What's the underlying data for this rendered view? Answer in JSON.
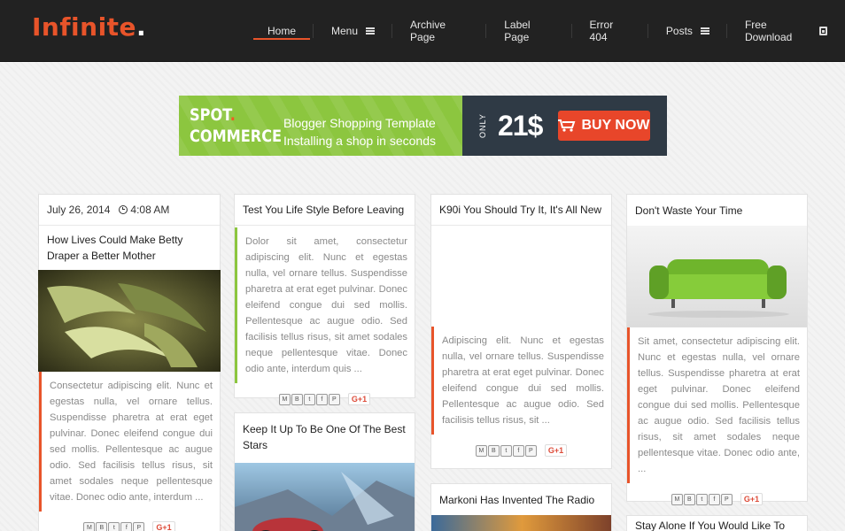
{
  "header": {
    "logo_text": "Infinite",
    "logo_dot": ".",
    "accent_color": "#e8542a",
    "nav": [
      {
        "label": "Home",
        "icon": ""
      },
      {
        "label": "Menu",
        "icon": "hamburger-icon"
      },
      {
        "label": "Archive Page",
        "icon": ""
      },
      {
        "label": "Label Page",
        "icon": ""
      },
      {
        "label": "Error 404",
        "icon": ""
      },
      {
        "label": "Posts",
        "icon": "hamburger-icon"
      },
      {
        "label": "Free Download",
        "icon": "save-icon"
      }
    ]
  },
  "banner": {
    "brand_line1": "SPOT",
    "brand_line2": "COMMERCE",
    "tagline1": "Blogger Shopping Template",
    "tagline2": "Installing a shop in seconds",
    "only": "ONLY",
    "price": "21$",
    "buy_label": "BUY NOW",
    "colors": {
      "green": "#8cc63f",
      "dark": "#2f3a45",
      "button": "#e8462a"
    }
  },
  "share": {
    "gplus": "G+1",
    "icons": [
      "email-icon",
      "blog-icon",
      "twitter-icon",
      "facebook-icon",
      "pinterest-icon"
    ]
  },
  "posts": [
    {
      "date": "July 26, 2014",
      "time": "4:08 AM",
      "title": "How Lives Could Make Betty Draper a Better Mother",
      "snippet": "Consectetur adipiscing elit. Nunc et egestas nulla, vel ornare tellus. Suspendisse pharetra at erat eget pulvinar. Donec eleifend congue dui sed mollis. Pellentesque ac augue odio. Sed facilisis tellus risus, sit amet sodales neque pellentesque vitae. Donec odio ante, interdum ...",
      "accent": "#e8542a"
    },
    {
      "title": "Test You Life Style Before Leaving",
      "snippet": "Dolor sit amet, consectetur adipiscing elit. Nunc et egestas nulla, vel ornare tellus. Suspendisse pharetra at erat eget pulvinar. Donec eleifend congue dui sed mollis. Pellentesque ac augue odio. Sed facilisis tellus risus, sit amet sodales neque pellentesque vitae. Donec odio ante, interdum quis ...",
      "accent": "#8cc63f"
    },
    {
      "title": "Keep It Up To Be One Of The Best Stars"
    },
    {
      "title": "K90i You Should Try It, It's All New",
      "snippet": "Adipiscing elit. Nunc et egestas nulla, vel ornare tellus. Suspendisse pharetra at erat eget pulvinar. Donec eleifend congue dui sed mollis. Pellentesque ac augue odio. Sed facilisis tellus risus, sit ...",
      "accent": "#e8542a"
    },
    {
      "title": "Markoni Has Invented The Radio"
    },
    {
      "title": "Don't Waste Your Time",
      "snippet": "Sit amet, consectetur adipiscing elit. Nunc et egestas nulla, vel ornare tellus. Suspendisse pharetra at erat eget pulvinar. Donec eleifend congue dui sed mollis. Pellentesque ac augue odio. Sed facilisis tellus risus, sit amet sodales neque pellentesque vitae. Donec odio ante, ...",
      "accent": "#e8542a"
    },
    {
      "title": "Stay Alone If You Would Like To Be ..."
    }
  ]
}
